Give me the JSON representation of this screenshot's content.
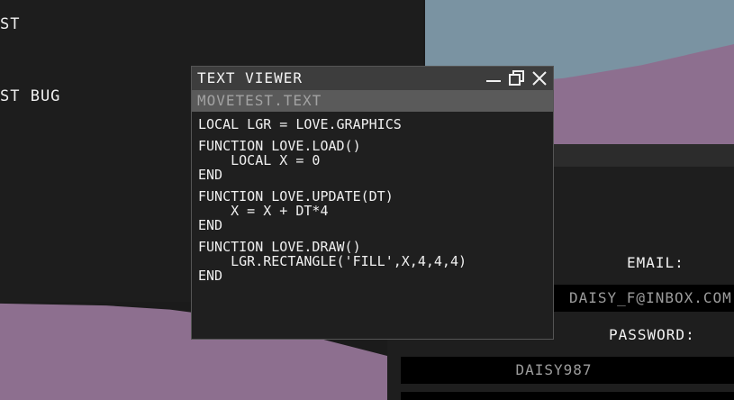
{
  "desktop": {
    "labels": [
      "ST",
      "ST BUG"
    ]
  },
  "text_viewer": {
    "title": "TEXT VIEWER",
    "file_name": "MOVETEST.TEXT",
    "buttons": [
      "minimize-icon",
      "maximize-icon",
      "close-icon"
    ],
    "lines": [
      "LOCAL LGR = LOVE.GRAPHICS",
      "FUNCTION LOVE.LOAD()",
      "    LOCAL X = 0",
      "END",
      "FUNCTION LOVE.UPDATE(DT)",
      "    X = X + DT*4",
      "END",
      "FUNCTION LOVE.DRAW()",
      "    LGR.RECTANGLE('FILL',X,4,4,4)",
      "END"
    ]
  },
  "login": {
    "email_label": "EMAIL:",
    "email_value": "DAISY_F@INBOX.COM",
    "password_label": "PASSWORD:",
    "password_value": "DAISY987"
  },
  "colors": {
    "sky": "#7a93a2",
    "hills": "#8d6f8f",
    "panel": "#1d1d1d",
    "titlebar": "#3d3d3d"
  }
}
